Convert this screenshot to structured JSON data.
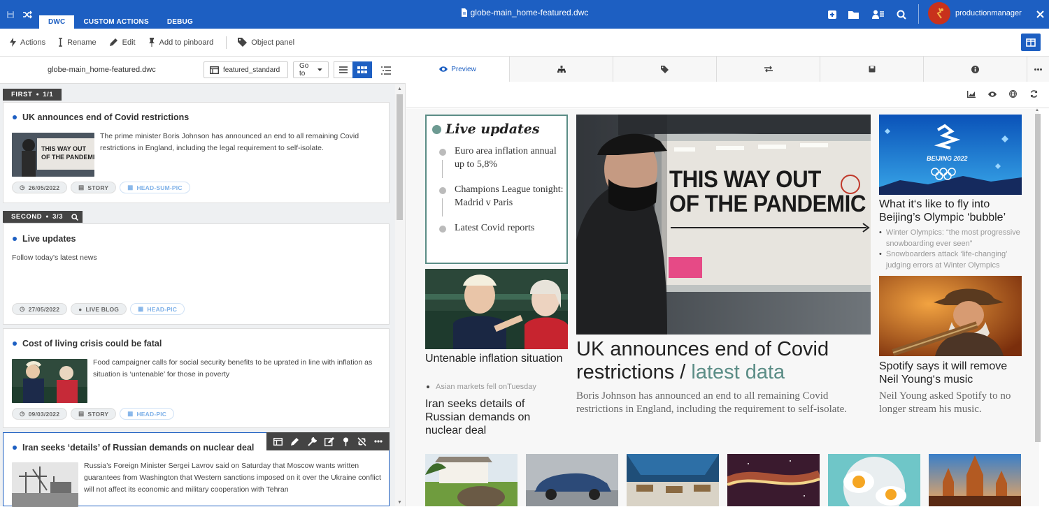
{
  "topbar": {
    "title": "globe-main_home-featured.dwc",
    "tabs": [
      "DWC",
      "CUSTOM ACTIONS",
      "DEBUG"
    ],
    "user": "productionmanager"
  },
  "toolbar": {
    "actions": "Actions",
    "rename": "Rename",
    "edit": "Edit",
    "pinboard": "Add to pinboard",
    "object_panel": "Object panel"
  },
  "left": {
    "file_name": "globe-main_home-featured.dwc",
    "layout": "featured_standard",
    "goto": "Go to",
    "groups": [
      {
        "label": "FIRST",
        "count": "1/1"
      },
      {
        "label": "SECOND",
        "count": "3/3"
      }
    ],
    "cards": [
      {
        "title": "UK announces end of Covid restrictions",
        "summary": "The prime minister Boris Johnson has announced an end to all remaining Covid restrictions in England, including the legal requirement to self-isolate.",
        "date": "26/05/2022",
        "type": "STORY",
        "template": "HEAD-SUM-PIC"
      },
      {
        "title": "Live updates",
        "summary": "Follow today's latest news",
        "date": "27/05/2022",
        "type": "LIVE BLOG",
        "template": "HEAD-PIC"
      },
      {
        "title": "Cost of living crisis could be fatal",
        "summary": "Food campaigner calls for social security benefits to be uprated in line with inflation as situation is ‘untenable’ for those in poverty",
        "date": "09/03/2022",
        "type": "STORY",
        "template": "HEAD-PIC"
      },
      {
        "title": "Iran seeks ‘details’ of Russian demands on nuclear deal",
        "summary": "Russia’s Foreign Minister Sergei Lavrov said on Saturday that Moscow wants written guarantees from Washington that Western sanctions imposed on it over the Ukraine conflict will not affect its economic and military cooperation with Tehran"
      }
    ]
  },
  "right": {
    "preview_tab": "Preview",
    "live": {
      "title": "Live updates",
      "items": [
        "Euro area inflation annual up to 5,8%",
        "Champions League tonight: Madrid v Paris",
        "Latest Covid reports"
      ]
    },
    "hero_sign": {
      "line1": "THIS WAY OUT",
      "line2": "OF THE PANDEMIC"
    },
    "hero": {
      "headline": "UK announces end of Covid restrictions / ",
      "highlight": "latest data",
      "summary": "Boris Johnson has announced an end to all remaining Covid restrictions in England, including the requirement to self-isolate."
    },
    "inflation": {
      "headline": "Untenable inflation situation",
      "related": "Asian markets fell onTuesday"
    },
    "iran": {
      "headline": "Iran seeks details of Russian demands on nuclear deal"
    },
    "olympics": {
      "headline": "What it‘s like to fly into Beijing’s Olympic ‘bubble’",
      "related": [
        "Winter Olympics: “the most progressive snowboarding ever seen”",
        "Snowboarders attack ‘life-changing’ judging errors at Winter Olympics"
      ],
      "logo": "BEIJING 2022"
    },
    "spotify": {
      "headline": "Spotify says it will remove Neil Young‘s music",
      "summary": "Neil Young asked Spotify to no longer stream his music."
    }
  }
}
